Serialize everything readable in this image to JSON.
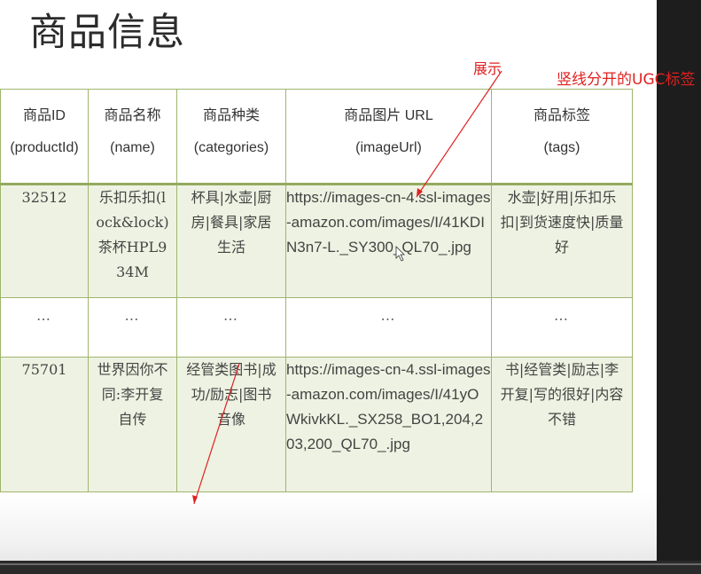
{
  "title": "商品信息",
  "annotations": {
    "show": "展示",
    "ugc": "竖线分开的UGC标签"
  },
  "table": {
    "headers": [
      {
        "cn": "商品ID",
        "en": "(productId)"
      },
      {
        "cn": "商品名称",
        "en": "(name)"
      },
      {
        "cn": "商品种类",
        "en": "(categories)"
      },
      {
        "cn": "商品图片 URL",
        "en": "(imageUrl)"
      },
      {
        "cn": "商品标签",
        "en": "(tags)"
      }
    ],
    "rows": [
      {
        "id": "32512",
        "name": "乐扣乐扣(lock&lock)茶杯HPL934M",
        "categories": "杯具|水壶|厨房|餐具|家居生活",
        "imageUrl": "https://images-cn-4.ssl-images-amazon.com/images/I/41KDIN3n7-L._SY300_QL70_.jpg",
        "tags": "水壶|好用|乐扣乐扣|到货速度快|质量好"
      },
      {
        "id": "…",
        "name": "…",
        "categories": "…",
        "imageUrl": "…",
        "tags": "…"
      },
      {
        "id": "75701",
        "name": "世界因你不同:李开复自传",
        "categories": "经管类图书|成功/励志|图书音像",
        "imageUrl": "https://images-cn-4.ssl-images-amazon.com/images/I/41yOWkivkKL._SX258_BO1,204,203,200_QL70_.jpg",
        "tags": "书|经管类|励志|李开复|写的很好|内容不错"
      }
    ]
  },
  "colors": {
    "annotation": "#e02020",
    "table_border": "#9fb56e",
    "row_fill": "#eef2e2"
  }
}
